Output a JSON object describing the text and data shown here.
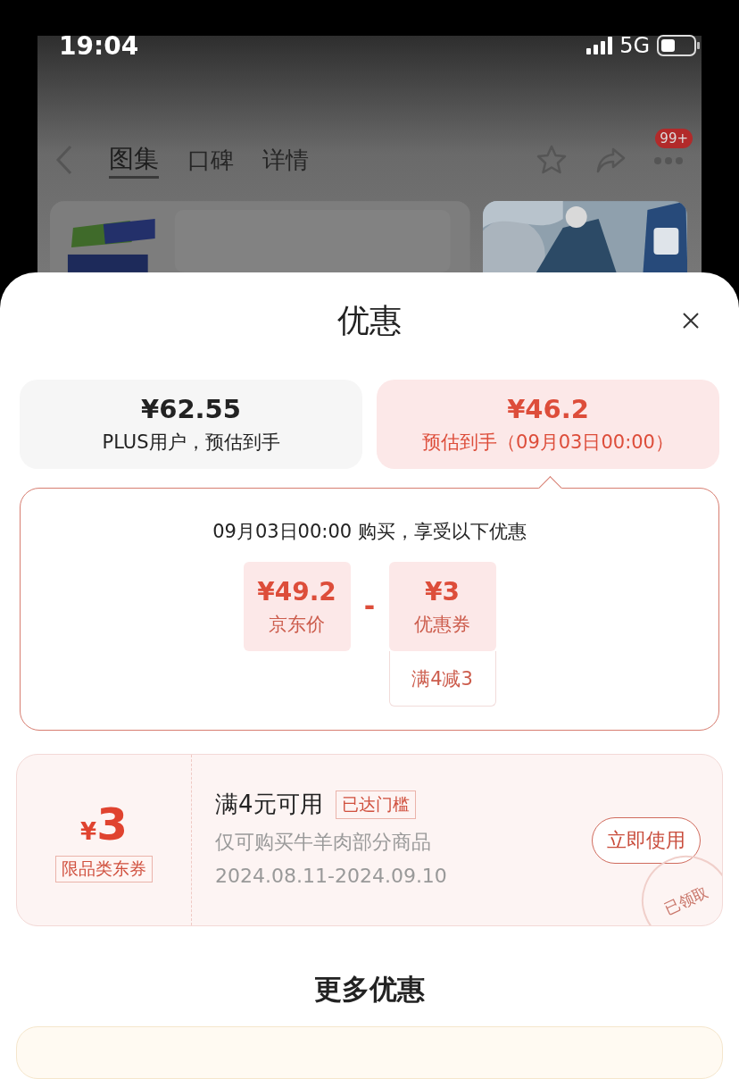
{
  "status_bar": {
    "time": "19:04",
    "network": "5G"
  },
  "nav": {
    "tabs": [
      {
        "label": "图集",
        "selected": true
      },
      {
        "label": "口碑",
        "selected": false
      },
      {
        "label": "详情",
        "selected": false
      }
    ],
    "badge": "99+"
  },
  "sheet": {
    "title": "优惠",
    "price_options": [
      {
        "price": "¥62.55",
        "caption": "PLUS用户，预估到手",
        "selected": false
      },
      {
        "price": "¥46.2",
        "caption": "预估到手（09月03日00:00）",
        "selected": true
      }
    ],
    "breakdown": {
      "heading": "09月03日00:00 购买，享受以下优惠",
      "operator": "-",
      "items": [
        {
          "amount": "¥49.2",
          "label": "京东价"
        },
        {
          "amount": "¥3",
          "label": "优惠券",
          "note": "满4减3"
        }
      ]
    },
    "coupons": [
      {
        "symbol": "¥",
        "amount": "3",
        "tag": "限品类东券",
        "title": "满4元可用",
        "status": "已达门槛",
        "description": "仅可购买牛羊肉部分商品",
        "validity": "2024.08.11-2024.09.10",
        "button": "立即使用",
        "stamp": "已领取"
      }
    ],
    "more_title": "更多优惠"
  }
}
